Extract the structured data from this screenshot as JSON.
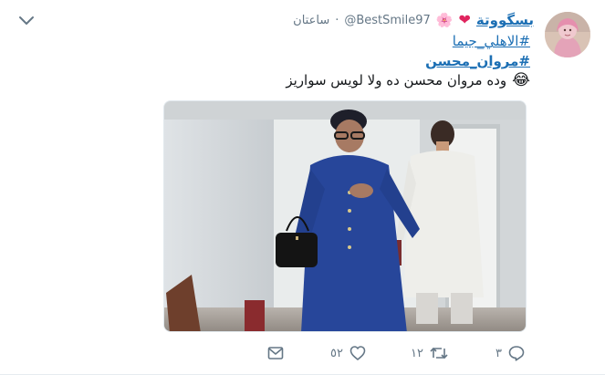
{
  "tweet": {
    "display_name": "بسگووتة",
    "handle": "@BestSmile97",
    "separator": "·",
    "timestamp": "ساعتان",
    "hashtags": [
      "#الاهلي_جيما",
      "#مروان_محسن"
    ],
    "text": "وده مروان محسن ده ولا لويس سواريز",
    "emoji": {
      "heart": "❤",
      "blossom": "🌸",
      "laugh": "😂"
    }
  },
  "actions": {
    "reply_count": "٣",
    "retweet_count": "١٢",
    "like_count": "٥٢"
  },
  "icons": {
    "menu": "chevron-down-icon",
    "reply": "reply-icon",
    "retweet": "retweet-icon",
    "like": "heart-icon",
    "dm": "envelope-icon"
  },
  "colors": {
    "link": "#1c6fb4",
    "muted": "#657786",
    "text": "#14171a"
  }
}
